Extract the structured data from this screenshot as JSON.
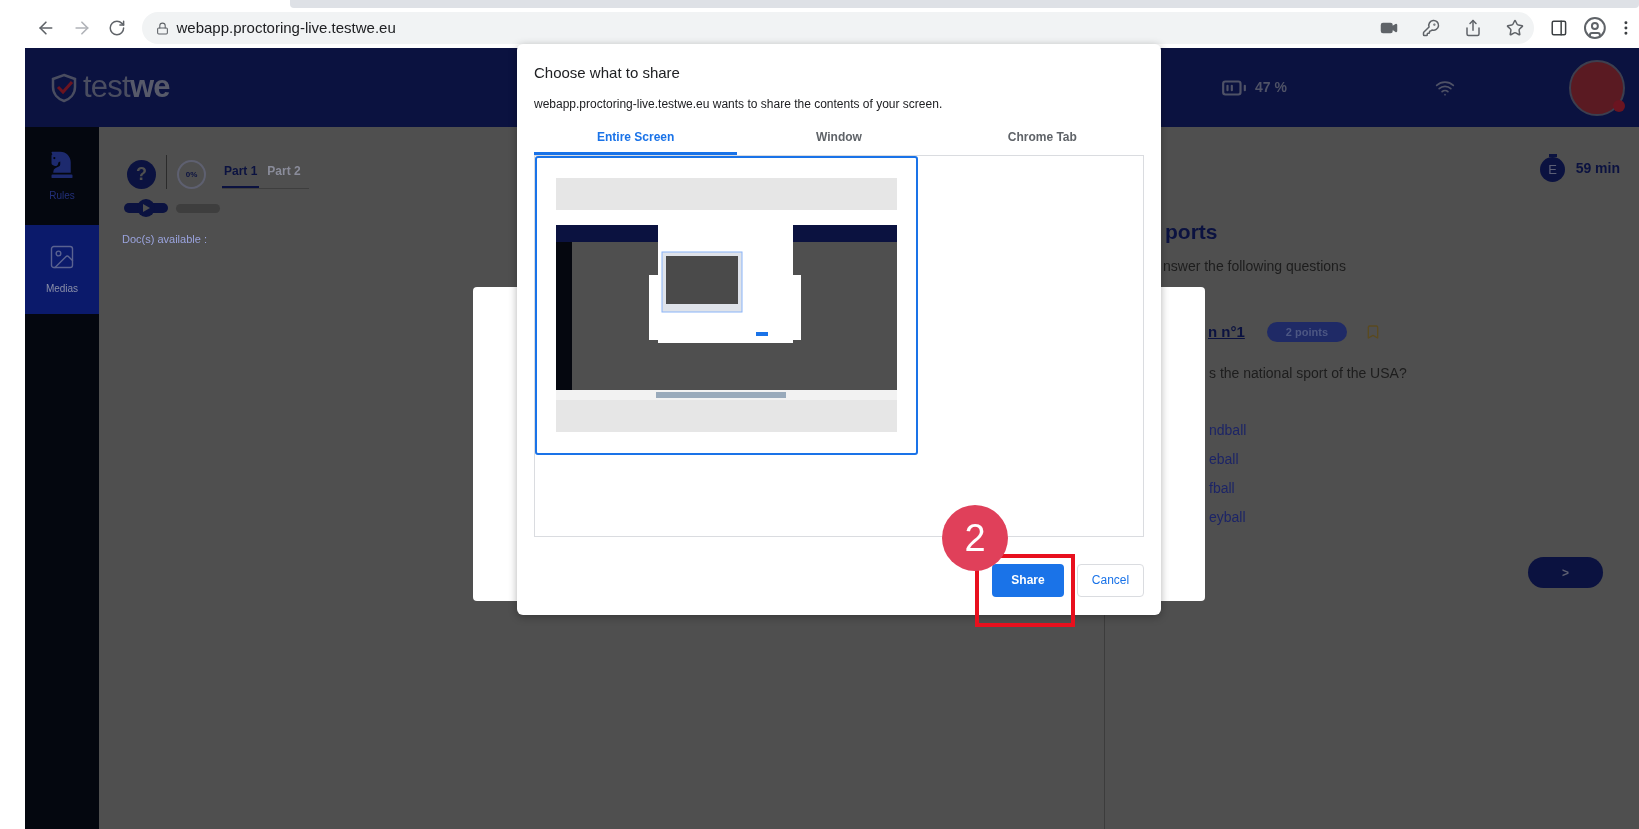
{
  "browser": {
    "url": "webapp.proctoring-live.testwe.eu"
  },
  "header": {
    "logo_light": "test",
    "logo_bold": "we",
    "battery": "47 %"
  },
  "sidebar": {
    "items": [
      {
        "kind": "rules",
        "label": "Rules",
        "selected": false
      },
      {
        "kind": "media",
        "label": "Medias",
        "selected": true
      }
    ]
  },
  "exam": {
    "help": "?",
    "progress": "0%",
    "parts": [
      {
        "label": "Part 1",
        "selected": true
      },
      {
        "label": "Part 2",
        "selected": false
      }
    ],
    "docs_label": "Doc(s) available :",
    "timer_letter": "E",
    "timer": "59 min"
  },
  "question": {
    "title": "ports",
    "instruction": "nswer the following questions",
    "number": "n n°1",
    "points": "2 points",
    "bookmarked": false,
    "prompt": "s the national sport of the USA?",
    "options": [
      "ndball",
      "eball",
      "fball",
      "eyball"
    ],
    "next": ">"
  },
  "share_dialog": {
    "title": "Choose what to share",
    "message": "webapp.proctoring-live.testwe.eu wants to share the contents of your screen.",
    "tabs": [
      {
        "label": "Entire Screen",
        "selected": true
      },
      {
        "label": "Window",
        "selected": false
      },
      {
        "label": "Chrome Tab",
        "selected": false
      }
    ],
    "screens": [
      {
        "selected": true
      }
    ],
    "share": "Share",
    "cancel": "Cancel"
  },
  "annotation": {
    "step": "2"
  }
}
